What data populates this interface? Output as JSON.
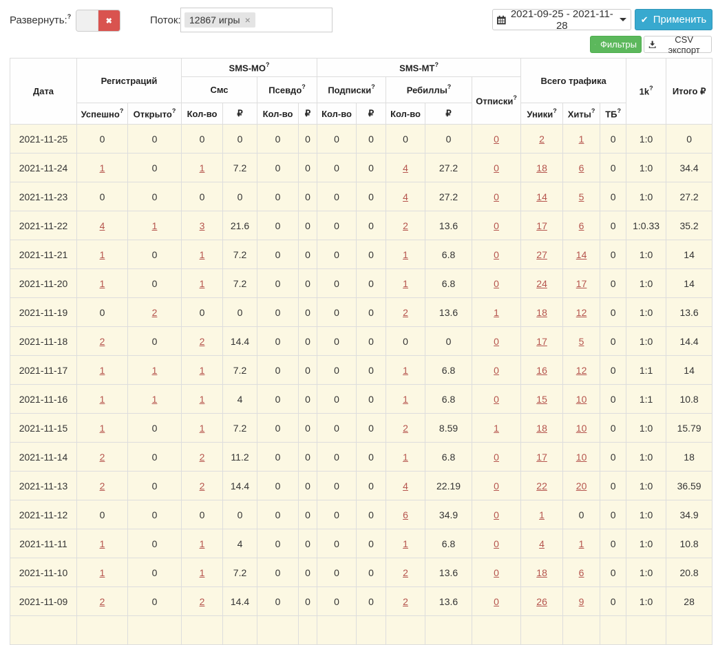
{
  "toolbar": {
    "expand_label": "Развернуть:",
    "flow_label": "Поток:",
    "flow_tag": "12867 игры",
    "tag_remove": "×",
    "toggle_x": "✖",
    "date_range": "2021-09-25 - 2021-11-28",
    "apply_label": "Применить",
    "apply_check": "✔",
    "filters_label": "Фильтры",
    "csv_label": "CSV экспорт",
    "help_mark": "?"
  },
  "colors": {
    "apply_teal": "#38a9cf",
    "filters_green": "#5cb85c",
    "toggle_red": "#d9534f",
    "link_red": "#b5544d",
    "row_bg_cream": "#fcf8e3"
  },
  "table": {
    "header": {
      "date": "Дата",
      "registrations": "Регистраций",
      "reg_success": "Успешно",
      "reg_open": "Открыто",
      "sms_mo": "SMS-MO",
      "sms": "Смс",
      "pseudo": "Псевдо",
      "sms_mt": "SMS-MT",
      "subs": "Подписки",
      "rebills": "Ребиллы",
      "unsubs": "Отписки",
      "count": "Кол-во",
      "rub": "₽",
      "traffic": "Всего трафика",
      "uniques": "Уники",
      "hits": "Хиты",
      "tb": "ТБ",
      "k1": "1k",
      "total": "Итого ₽"
    },
    "cell_names": [
      "reg-success-cell",
      "reg-open-cell",
      "sms-count-cell",
      "sms-rub-cell",
      "pseudo-count-cell",
      "pseudo-rub-cell",
      "subs-count-cell",
      "subs-rub-cell",
      "rebills-count-cell",
      "rebills-rub-cell",
      "unsubs-cell",
      "uniques-cell",
      "hits-cell",
      "tb-cell",
      "ratio-cell",
      "total-cell"
    ],
    "rows": [
      {
        "date": "2021-11-25",
        "cells": [
          [
            "0",
            0
          ],
          [
            "0",
            0
          ],
          [
            "0",
            0
          ],
          [
            "0",
            0
          ],
          [
            "0",
            0
          ],
          [
            "0",
            0
          ],
          [
            "0",
            0
          ],
          [
            "0",
            0
          ],
          [
            "0",
            0
          ],
          [
            "0",
            0
          ],
          [
            "0",
            1
          ],
          [
            "2",
            1
          ],
          [
            "1",
            1
          ],
          [
            "0",
            0
          ],
          [
            "1:0",
            0
          ],
          [
            "0",
            0
          ]
        ]
      },
      {
        "date": "2021-11-24",
        "cells": [
          [
            "1",
            1
          ],
          [
            "0",
            0
          ],
          [
            "1",
            1
          ],
          [
            "7.2",
            0
          ],
          [
            "0",
            0
          ],
          [
            "0",
            0
          ],
          [
            "0",
            0
          ],
          [
            "0",
            0
          ],
          [
            "4",
            1
          ],
          [
            "27.2",
            0
          ],
          [
            "0",
            1
          ],
          [
            "18",
            1
          ],
          [
            "6",
            1
          ],
          [
            "0",
            0
          ],
          [
            "1:0",
            0
          ],
          [
            "34.4",
            0
          ]
        ]
      },
      {
        "date": "2021-11-23",
        "cells": [
          [
            "0",
            0
          ],
          [
            "0",
            0
          ],
          [
            "0",
            0
          ],
          [
            "0",
            0
          ],
          [
            "0",
            0
          ],
          [
            "0",
            0
          ],
          [
            "0",
            0
          ],
          [
            "0",
            0
          ],
          [
            "4",
            1
          ],
          [
            "27.2",
            0
          ],
          [
            "0",
            1
          ],
          [
            "14",
            1
          ],
          [
            "5",
            1
          ],
          [
            "0",
            0
          ],
          [
            "1:0",
            0
          ],
          [
            "27.2",
            0
          ]
        ]
      },
      {
        "date": "2021-11-22",
        "cells": [
          [
            "4",
            1
          ],
          [
            "1",
            1
          ],
          [
            "3",
            1
          ],
          [
            "21.6",
            0
          ],
          [
            "0",
            0
          ],
          [
            "0",
            0
          ],
          [
            "0",
            0
          ],
          [
            "0",
            0
          ],
          [
            "2",
            1
          ],
          [
            "13.6",
            0
          ],
          [
            "0",
            1
          ],
          [
            "17",
            1
          ],
          [
            "6",
            1
          ],
          [
            "0",
            0
          ],
          [
            "1:0.33",
            0
          ],
          [
            "35.2",
            0
          ]
        ]
      },
      {
        "date": "2021-11-21",
        "cells": [
          [
            "1",
            1
          ],
          [
            "0",
            0
          ],
          [
            "1",
            1
          ],
          [
            "7.2",
            0
          ],
          [
            "0",
            0
          ],
          [
            "0",
            0
          ],
          [
            "0",
            0
          ],
          [
            "0",
            0
          ],
          [
            "1",
            1
          ],
          [
            "6.8",
            0
          ],
          [
            "0",
            1
          ],
          [
            "27",
            1
          ],
          [
            "14",
            1
          ],
          [
            "0",
            0
          ],
          [
            "1:0",
            0
          ],
          [
            "14",
            0
          ]
        ]
      },
      {
        "date": "2021-11-20",
        "cells": [
          [
            "1",
            1
          ],
          [
            "0",
            0
          ],
          [
            "1",
            1
          ],
          [
            "7.2",
            0
          ],
          [
            "0",
            0
          ],
          [
            "0",
            0
          ],
          [
            "0",
            0
          ],
          [
            "0",
            0
          ],
          [
            "1",
            1
          ],
          [
            "6.8",
            0
          ],
          [
            "0",
            1
          ],
          [
            "24",
            1
          ],
          [
            "17",
            1
          ],
          [
            "0",
            0
          ],
          [
            "1:0",
            0
          ],
          [
            "14",
            0
          ]
        ]
      },
      {
        "date": "2021-11-19",
        "cells": [
          [
            "0",
            0
          ],
          [
            "2",
            1
          ],
          [
            "0",
            0
          ],
          [
            "0",
            0
          ],
          [
            "0",
            0
          ],
          [
            "0",
            0
          ],
          [
            "0",
            0
          ],
          [
            "0",
            0
          ],
          [
            "2",
            1
          ],
          [
            "13.6",
            0
          ],
          [
            "1",
            1
          ],
          [
            "18",
            1
          ],
          [
            "12",
            1
          ],
          [
            "0",
            0
          ],
          [
            "1:0",
            0
          ],
          [
            "13.6",
            0
          ]
        ]
      },
      {
        "date": "2021-11-18",
        "cells": [
          [
            "2",
            1
          ],
          [
            "0",
            0
          ],
          [
            "2",
            1
          ],
          [
            "14.4",
            0
          ],
          [
            "0",
            0
          ],
          [
            "0",
            0
          ],
          [
            "0",
            0
          ],
          [
            "0",
            0
          ],
          [
            "0",
            0
          ],
          [
            "0",
            0
          ],
          [
            "0",
            1
          ],
          [
            "17",
            1
          ],
          [
            "5",
            1
          ],
          [
            "0",
            0
          ],
          [
            "1:0",
            0
          ],
          [
            "14.4",
            0
          ]
        ]
      },
      {
        "date": "2021-11-17",
        "cells": [
          [
            "1",
            1
          ],
          [
            "1",
            1
          ],
          [
            "1",
            1
          ],
          [
            "7.2",
            0
          ],
          [
            "0",
            0
          ],
          [
            "0",
            0
          ],
          [
            "0",
            0
          ],
          [
            "0",
            0
          ],
          [
            "1",
            1
          ],
          [
            "6.8",
            0
          ],
          [
            "0",
            1
          ],
          [
            "16",
            1
          ],
          [
            "12",
            1
          ],
          [
            "0",
            0
          ],
          [
            "1:1",
            0
          ],
          [
            "14",
            0
          ]
        ]
      },
      {
        "date": "2021-11-16",
        "cells": [
          [
            "1",
            1
          ],
          [
            "1",
            1
          ],
          [
            "1",
            1
          ],
          [
            "4",
            0
          ],
          [
            "0",
            0
          ],
          [
            "0",
            0
          ],
          [
            "0",
            0
          ],
          [
            "0",
            0
          ],
          [
            "1",
            1
          ],
          [
            "6.8",
            0
          ],
          [
            "0",
            1
          ],
          [
            "15",
            1
          ],
          [
            "10",
            1
          ],
          [
            "0",
            0
          ],
          [
            "1:1",
            0
          ],
          [
            "10.8",
            0
          ]
        ]
      },
      {
        "date": "2021-11-15",
        "cells": [
          [
            "1",
            1
          ],
          [
            "0",
            0
          ],
          [
            "1",
            1
          ],
          [
            "7.2",
            0
          ],
          [
            "0",
            0
          ],
          [
            "0",
            0
          ],
          [
            "0",
            0
          ],
          [
            "0",
            0
          ],
          [
            "2",
            1
          ],
          [
            "8.59",
            0
          ],
          [
            "1",
            1
          ],
          [
            "18",
            1
          ],
          [
            "10",
            1
          ],
          [
            "0",
            0
          ],
          [
            "1:0",
            0
          ],
          [
            "15.79",
            0
          ]
        ]
      },
      {
        "date": "2021-11-14",
        "cells": [
          [
            "2",
            1
          ],
          [
            "0",
            0
          ],
          [
            "2",
            1
          ],
          [
            "11.2",
            0
          ],
          [
            "0",
            0
          ],
          [
            "0",
            0
          ],
          [
            "0",
            0
          ],
          [
            "0",
            0
          ],
          [
            "1",
            1
          ],
          [
            "6.8",
            0
          ],
          [
            "0",
            1
          ],
          [
            "17",
            1
          ],
          [
            "10",
            1
          ],
          [
            "0",
            0
          ],
          [
            "1:0",
            0
          ],
          [
            "18",
            0
          ]
        ]
      },
      {
        "date": "2021-11-13",
        "cells": [
          [
            "2",
            1
          ],
          [
            "0",
            0
          ],
          [
            "2",
            1
          ],
          [
            "14.4",
            0
          ],
          [
            "0",
            0
          ],
          [
            "0",
            0
          ],
          [
            "0",
            0
          ],
          [
            "0",
            0
          ],
          [
            "4",
            1
          ],
          [
            "22.19",
            0
          ],
          [
            "0",
            1
          ],
          [
            "22",
            1
          ],
          [
            "20",
            1
          ],
          [
            "0",
            0
          ],
          [
            "1:0",
            0
          ],
          [
            "36.59",
            0
          ]
        ]
      },
      {
        "date": "2021-11-12",
        "cells": [
          [
            "0",
            0
          ],
          [
            "0",
            0
          ],
          [
            "0",
            0
          ],
          [
            "0",
            0
          ],
          [
            "0",
            0
          ],
          [
            "0",
            0
          ],
          [
            "0",
            0
          ],
          [
            "0",
            0
          ],
          [
            "6",
            1
          ],
          [
            "34.9",
            0
          ],
          [
            "0",
            1
          ],
          [
            "1",
            1
          ],
          [
            "0",
            0
          ],
          [
            "0",
            0
          ],
          [
            "1:0",
            0
          ],
          [
            "34.9",
            0
          ]
        ]
      },
      {
        "date": "2021-11-11",
        "cells": [
          [
            "1",
            1
          ],
          [
            "0",
            0
          ],
          [
            "1",
            1
          ],
          [
            "4",
            0
          ],
          [
            "0",
            0
          ],
          [
            "0",
            0
          ],
          [
            "0",
            0
          ],
          [
            "0",
            0
          ],
          [
            "1",
            1
          ],
          [
            "6.8",
            0
          ],
          [
            "0",
            1
          ],
          [
            "4",
            1
          ],
          [
            "1",
            1
          ],
          [
            "0",
            0
          ],
          [
            "1:0",
            0
          ],
          [
            "10.8",
            0
          ]
        ]
      },
      {
        "date": "2021-11-10",
        "cells": [
          [
            "1",
            1
          ],
          [
            "0",
            0
          ],
          [
            "1",
            1
          ],
          [
            "7.2",
            0
          ],
          [
            "0",
            0
          ],
          [
            "0",
            0
          ],
          [
            "0",
            0
          ],
          [
            "0",
            0
          ],
          [
            "2",
            1
          ],
          [
            "13.6",
            0
          ],
          [
            "0",
            1
          ],
          [
            "18",
            1
          ],
          [
            "6",
            1
          ],
          [
            "0",
            0
          ],
          [
            "1:0",
            0
          ],
          [
            "20.8",
            0
          ]
        ]
      },
      {
        "date": "2021-11-09",
        "cells": [
          [
            "2",
            1
          ],
          [
            "0",
            0
          ],
          [
            "2",
            1
          ],
          [
            "14.4",
            0
          ],
          [
            "0",
            0
          ],
          [
            "0",
            0
          ],
          [
            "0",
            0
          ],
          [
            "0",
            0
          ],
          [
            "2",
            1
          ],
          [
            "13.6",
            0
          ],
          [
            "0",
            1
          ],
          [
            "26",
            1
          ],
          [
            "9",
            1
          ],
          [
            "0",
            0
          ],
          [
            "1:0",
            0
          ],
          [
            "28",
            0
          ]
        ]
      }
    ]
  }
}
